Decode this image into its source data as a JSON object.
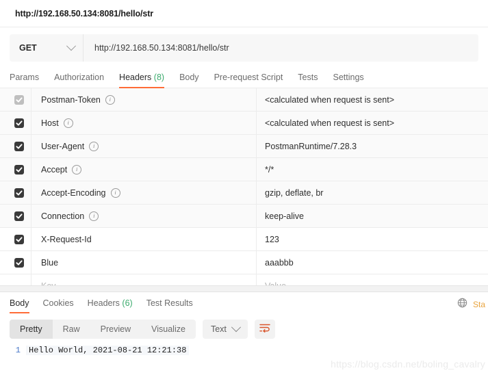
{
  "titlebar": {
    "tab_title": "http://192.168.50.134:8081/hello/str"
  },
  "request": {
    "method": "GET",
    "method_chevron_icon": "chevron-down-icon",
    "url": "http://192.168.50.134:8081/hello/str",
    "tabs": [
      {
        "label": "Params",
        "count": "",
        "active": false
      },
      {
        "label": "Authorization",
        "count": "",
        "active": false
      },
      {
        "label": "Headers",
        "count": "(8)",
        "active": true
      },
      {
        "label": "Body",
        "count": "",
        "active": false
      },
      {
        "label": "Pre-request Script",
        "count": "",
        "active": false
      },
      {
        "label": "Tests",
        "count": "",
        "active": false
      },
      {
        "label": "Settings",
        "count": "",
        "active": false
      }
    ]
  },
  "headers_table": {
    "placeholder_key": "Key",
    "placeholder_value": "Value",
    "rows": [
      {
        "checked": true,
        "disabled": true,
        "shaded": true,
        "key": "Postman-Token",
        "info": true,
        "value": "<calculated when request is sent>"
      },
      {
        "checked": true,
        "disabled": false,
        "shaded": true,
        "key": "Host",
        "info": true,
        "value": "<calculated when request is sent>"
      },
      {
        "checked": true,
        "disabled": false,
        "shaded": true,
        "key": "User-Agent",
        "info": true,
        "value": "PostmanRuntime/7.28.3"
      },
      {
        "checked": true,
        "disabled": false,
        "shaded": true,
        "key": "Accept",
        "info": true,
        "value": "*/*"
      },
      {
        "checked": true,
        "disabled": false,
        "shaded": true,
        "key": "Accept-Encoding",
        "info": true,
        "value": "gzip, deflate, br"
      },
      {
        "checked": true,
        "disabled": false,
        "shaded": true,
        "key": "Connection",
        "info": true,
        "value": "keep-alive"
      },
      {
        "checked": true,
        "disabled": false,
        "shaded": false,
        "key": "X-Request-Id",
        "info": false,
        "value": "123"
      },
      {
        "checked": true,
        "disabled": false,
        "shaded": false,
        "key": "Blue",
        "info": false,
        "value": "aaabbb",
        "highlighted": true
      }
    ]
  },
  "response": {
    "tabs": [
      {
        "label": "Body",
        "count": "",
        "active": true
      },
      {
        "label": "Cookies",
        "count": "",
        "active": false
      },
      {
        "label": "Headers",
        "count": "(6)",
        "active": false
      },
      {
        "label": "Test Results",
        "count": "",
        "active": false
      }
    ],
    "globe_icon": "globe-icon",
    "status_label": "Sta",
    "view_modes": [
      {
        "label": "Pretty",
        "active": true
      },
      {
        "label": "Raw",
        "active": false
      },
      {
        "label": "Preview",
        "active": false
      },
      {
        "label": "Visualize",
        "active": false
      }
    ],
    "format_select": {
      "value": "Text",
      "chevron_icon": "chevron-down-icon"
    },
    "wrap_icon": "wrap-lines-icon",
    "body": {
      "line_number": "1",
      "text": "Hello World, 2021-08-21 12:21:38"
    }
  },
  "watermark": {
    "text": "https://blog.csdn.net/boling_cavalry"
  },
  "colors": {
    "accent": "#ff6c37",
    "count_green": "#3bab6d",
    "annotation_red": "#ff0000",
    "status_orange": "#e8a33d"
  }
}
